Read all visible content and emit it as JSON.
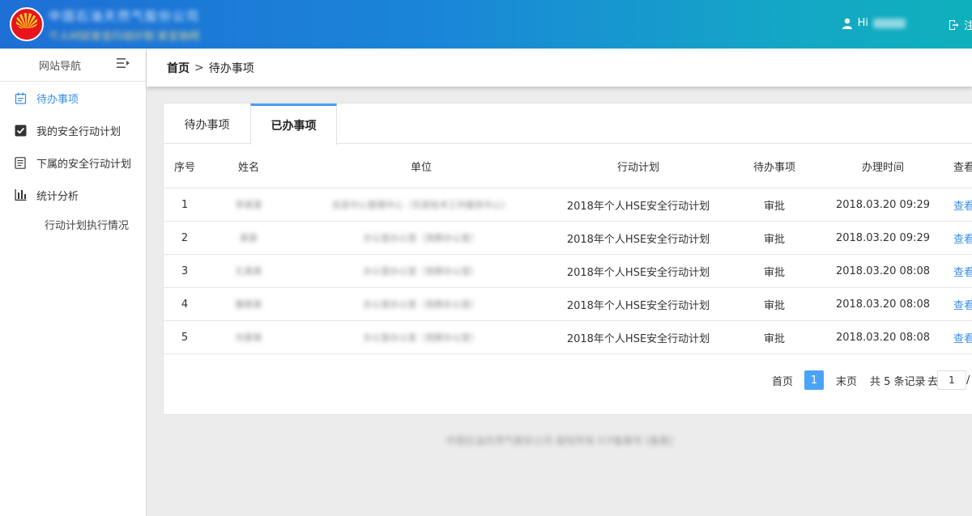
{
  "header": {
    "company_name": "中国石油天然气股份公司",
    "system_name": "个人HSE安全行动计划 安全协同",
    "greeting": "Hi",
    "username": "",
    "logout_label": "注销"
  },
  "sidebar": {
    "title": "网站导航",
    "items": [
      {
        "label": "待办事项",
        "icon": "calendar-icon"
      },
      {
        "label": "我的安全行动计划",
        "icon": "checkbox-icon"
      },
      {
        "label": "下属的安全行动计划",
        "icon": "document-icon"
      },
      {
        "label": "统计分析",
        "icon": "bar-chart-icon"
      }
    ],
    "sub_items": [
      {
        "label": "行动计划执行情况"
      }
    ]
  },
  "breadcrumb": {
    "home": "首页",
    "separator": ">",
    "current": "待办事项"
  },
  "tabs": [
    {
      "label": "待办事项"
    },
    {
      "label": "已办事项"
    }
  ],
  "table": {
    "headers": [
      "序号",
      "姓名",
      "单位",
      "行动计划",
      "待办事项",
      "办理时间",
      "查看"
    ],
    "rows": [
      {
        "idx": "1",
        "name": "李某某",
        "unit": "信息中心管理中心（东部技术工作服务中心）",
        "plan": "2018年个人HSE安全行动计划",
        "todo": "审批",
        "time": "2018.03.20 09:29",
        "op": "查看"
      },
      {
        "idx": "2",
        "name": "某某",
        "unit": "办公室办公室（党群办公室）",
        "plan": "2018年个人HSE安全行动计划",
        "todo": "审批",
        "time": "2018.03.20 09:29",
        "op": "查看"
      },
      {
        "idx": "3",
        "name": "孔某某",
        "unit": "办公室办公室（党群办公室）",
        "plan": "2018年个人HSE安全行动计划",
        "todo": "审批",
        "time": "2018.03.20 08:08",
        "op": "查看"
      },
      {
        "idx": "4",
        "name": "魏某某",
        "unit": "办公室办公室（党群办公室）",
        "plan": "2018年个人HSE安全行动计划",
        "todo": "审批",
        "time": "2018.03.20 08:08",
        "op": "查看"
      },
      {
        "idx": "5",
        "name": "刘某某",
        "unit": "办公室办公室（党群办公室）",
        "plan": "2018年个人HSE安全行动计划",
        "todo": "审批",
        "time": "2018.03.20 08:08",
        "op": "查看"
      }
    ]
  },
  "pagination": {
    "first": "首页",
    "current_page": "1",
    "last": "末页",
    "total": "共 5 条记录",
    "goto_label": "去",
    "goto_value": "1",
    "slash": "/"
  },
  "footer": {
    "text": "中国石油天然气股份公司 版权所有 ICP备案号 [备案]"
  },
  "colors": {
    "header_gradient_start": "#1e6fd6",
    "header_gradient_end": "#0fb0bd",
    "accent": "#3a8ee6",
    "active_tab_border": "#4a9ff0",
    "page_button": "#4aa3f5"
  }
}
